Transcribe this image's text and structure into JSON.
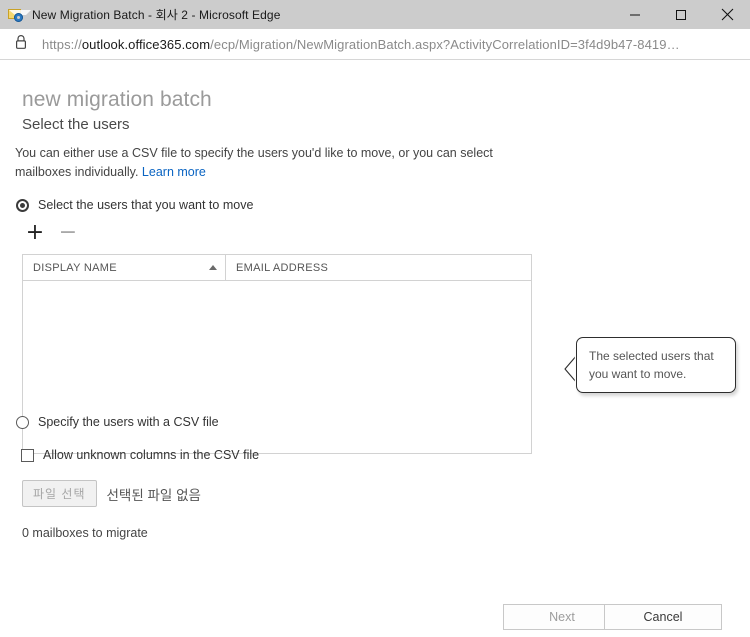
{
  "window": {
    "title": "New Migration Batch - 회사 2 - Microsoft Edge",
    "icon": "exchange-admin-envelope-gear-icon",
    "minimize_label": "minimize-icon",
    "maximize_label": "maximize-icon",
    "close_label": "close-icon"
  },
  "addressbar": {
    "lock_icon": "padlock-icon",
    "scheme": "https://",
    "host": "outlook.office365.com",
    "path": "/ecp/Migration/NewMigrationBatch.aspx?ActivityCorrelationID=3f4d9b47-8419…"
  },
  "page": {
    "title": "new migration batch",
    "subtitle": "Select the users",
    "intro_text": "You can either use a CSV file to specify the users you'd like to move, or you can select mailboxes individually. ",
    "learn_more_label": "Learn more"
  },
  "options": {
    "select_users_label": "Select the users that you want to move",
    "select_users_checked": true,
    "specify_csv_label": "Specify the users with a CSV file",
    "specify_csv_checked": false,
    "allow_unknown_columns_label": "Allow unknown columns in the CSV file",
    "allow_unknown_columns_checked": false
  },
  "toolbar": {
    "add_label": "+",
    "remove_label": "−"
  },
  "table": {
    "columns": [
      {
        "label": "DISPLAY NAME",
        "sorted": "ascending"
      },
      {
        "label": "EMAIL ADDRESS",
        "sorted": "none"
      }
    ],
    "rows": []
  },
  "callout": {
    "text": "The selected users that you want to move."
  },
  "filepicker": {
    "button_label": "파일 선택",
    "status_label": "선택된 파일 없음",
    "disabled": true
  },
  "status": {
    "mailbox_count_label": "0 mailboxes to migrate"
  },
  "footer": {
    "next_label": "Next",
    "next_disabled": true,
    "cancel_label": "Cancel"
  },
  "colors": {
    "titlebar_bg": "#cccccc",
    "link": "#0a64c2",
    "heading": "#9a9a9a",
    "cursor_hand": "#a8e01a"
  }
}
